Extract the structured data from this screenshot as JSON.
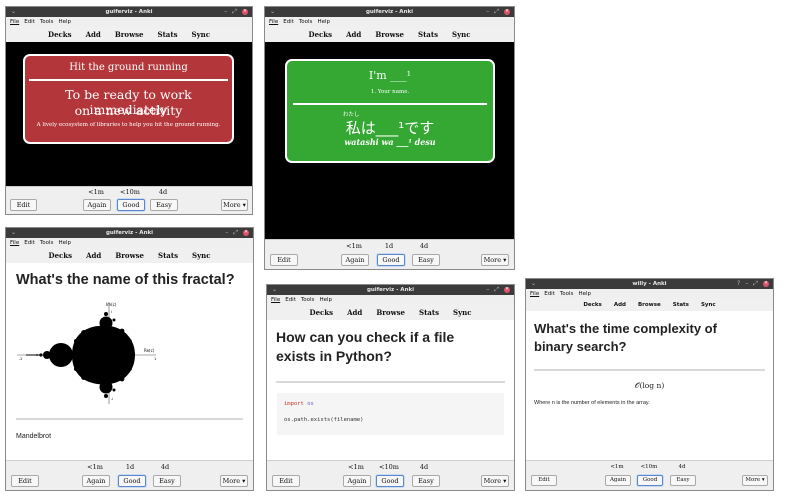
{
  "menu": {
    "file": "File",
    "edit": "Edit",
    "tools": "Tools",
    "help": "Help"
  },
  "toolbar": {
    "decks": "Decks",
    "add": "Add",
    "browse": "Browse",
    "stats": "Stats",
    "sync": "Sync"
  },
  "buttons": {
    "edit": "Edit",
    "again": "Again",
    "good": "Good",
    "easy": "Easy",
    "more": "More ▾"
  },
  "win1": {
    "title": "guiferviz - Anki",
    "ivl_again": "<1m",
    "ivl_good": "<10m",
    "ivl_easy": "4d",
    "card": {
      "front": "Hit the ground running",
      "back1": "To be ready to work immediately",
      "back2": "on a new activity",
      "note": "A lively ecosystem of libraries to help you hit the ground running.",
      "color": "#b3363a"
    }
  },
  "win2": {
    "title": "guiferviz - Anki",
    "ivl_again": "<1m",
    "ivl_good": "1d",
    "ivl_easy": "4d",
    "card": {
      "front": "I'm ___¹",
      "hint": "1. Your name.",
      "furigana": "わたし",
      "jp": "私は___¹です",
      "romaji": "watashi wa ___¹ desu",
      "color": "#34a833"
    }
  },
  "win3": {
    "title": "guiferviz - Anki",
    "ivl_again": "<1m",
    "ivl_good": "1d",
    "ivl_easy": "4d",
    "question": "What's the name of this fractal?",
    "answer": "Mandelbrot",
    "fractal": {
      "y_label": "Im(c)",
      "x_label": "Re(c)",
      "tick_neg2": "-2",
      "tick_1": "1",
      "tick_i": "i",
      "tick_neg_i": "-i"
    }
  },
  "win4": {
    "title": "guiferviz - Anki",
    "ivl_again": "<1m",
    "ivl_good": "<10m",
    "ivl_easy": "4d",
    "question1": "How can you check if a file",
    "question2": "exists in Python?",
    "code": {
      "kw_import": "import",
      "kw_mod": "os",
      "line2": "os.path.exists(filename)"
    }
  },
  "win5": {
    "title": "willy - Anki",
    "ivl_again": "<1m",
    "ivl_good": "<10m",
    "ivl_easy": "4d",
    "question1": "What's the time complexity of",
    "question2": "binary search?",
    "formula": "𝒪(log n)",
    "note": "Where n is the number of elements in the array."
  }
}
